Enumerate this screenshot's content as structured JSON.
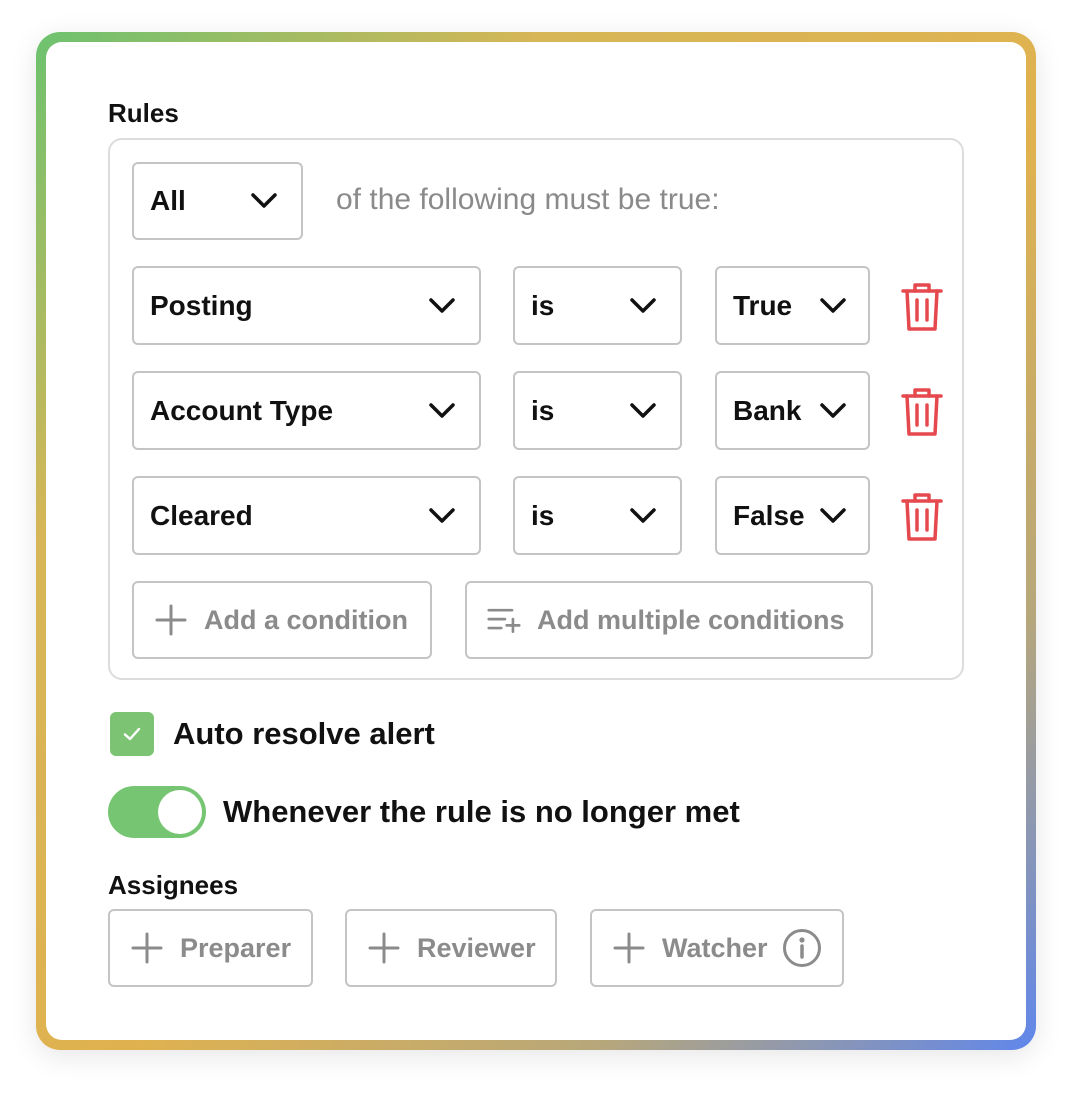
{
  "rules": {
    "title": "Rules",
    "quantifier": {
      "value": "All"
    },
    "quantifier_suffix": "of the following must be true:",
    "conditions": [
      {
        "field": "Posting",
        "operator": "is",
        "value": "True"
      },
      {
        "field": "Account Type",
        "operator": "is",
        "value": "Bank"
      },
      {
        "field": "Cleared",
        "operator": "is",
        "value": "False"
      }
    ],
    "add_condition_label": "Add a condition",
    "add_multiple_label": "Add multiple conditions"
  },
  "auto_resolve": {
    "label": "Auto resolve alert",
    "checked": true
  },
  "whenever_toggle": {
    "label": "Whenever the rule is no longer met",
    "on": true
  },
  "assignees": {
    "title": "Assignees",
    "buttons": {
      "preparer": "Preparer",
      "reviewer": "Reviewer",
      "watcher": "Watcher"
    }
  },
  "colors": {
    "accent_green": "#76c573",
    "delete_red": "#e5484d",
    "muted_text": "#8b8b8b",
    "border": "#c4c4c4"
  },
  "icons": [
    "chevron-down-icon",
    "trash-icon",
    "plus-icon",
    "list-add-icon",
    "check-icon",
    "info-icon"
  ]
}
